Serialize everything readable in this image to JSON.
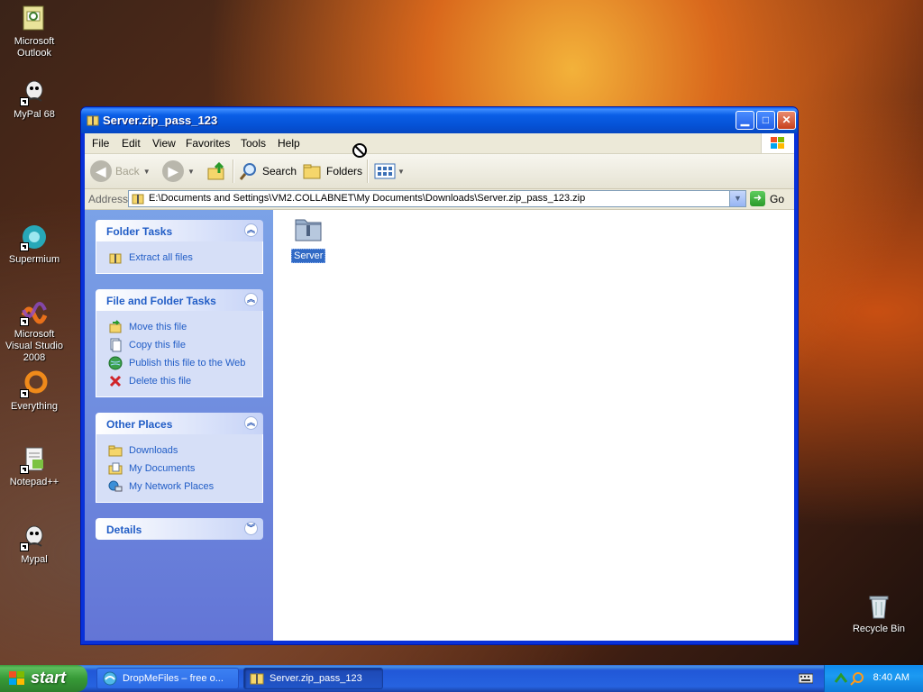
{
  "desktop": {
    "icons": [
      {
        "label": "Microsoft Outlook",
        "icon": "outlook-icon"
      },
      {
        "label": "MyPal 68",
        "icon": "mypal-icon"
      },
      {
        "label": "Supermium",
        "icon": "supermium-icon"
      },
      {
        "label": "Microsoft Visual Studio 2008",
        "icon": "visual-studio-icon"
      },
      {
        "label": "Everything",
        "icon": "everything-icon"
      },
      {
        "label": "Notepad++",
        "icon": "notepadpp-icon"
      },
      {
        "label": "Mypal",
        "icon": "mypal-icon"
      },
      {
        "label": "Recycle Bin",
        "icon": "recycle-bin-icon"
      }
    ]
  },
  "window": {
    "title": "Server.zip_pass_123",
    "menu": [
      "File",
      "Edit",
      "View",
      "Favorites",
      "Tools",
      "Help"
    ],
    "toolbar": {
      "back": "Back",
      "search": "Search",
      "folders": "Folders"
    },
    "address": {
      "label": "Address",
      "value": "E:\\Documents and Settings\\VM2.COLLABNET\\My Documents\\Downloads\\Server.zip_pass_123.zip",
      "go": "Go"
    },
    "taskpane": {
      "folder_tasks": {
        "title": "Folder Tasks",
        "items": [
          "Extract all files"
        ]
      },
      "file_folder_tasks": {
        "title": "File and Folder Tasks",
        "items": [
          "Move this file",
          "Copy this file",
          "Publish this file to the Web",
          "Delete this file"
        ]
      },
      "other_places": {
        "title": "Other Places",
        "items": [
          "Downloads",
          "My Documents",
          "My Network Places"
        ]
      },
      "details": {
        "title": "Details"
      }
    },
    "content": {
      "items": [
        {
          "name": "Server",
          "selected": true
        }
      ]
    }
  },
  "taskbar": {
    "start": "start",
    "tasks": [
      "DropMeFiles – free o...",
      "Server.zip_pass_123"
    ],
    "clock": "8:40 AM"
  },
  "colors": {
    "xp_blue": "#0831d9",
    "link_blue": "#215dc6",
    "selection": "#316ac5",
    "start_green": "#379a37"
  }
}
